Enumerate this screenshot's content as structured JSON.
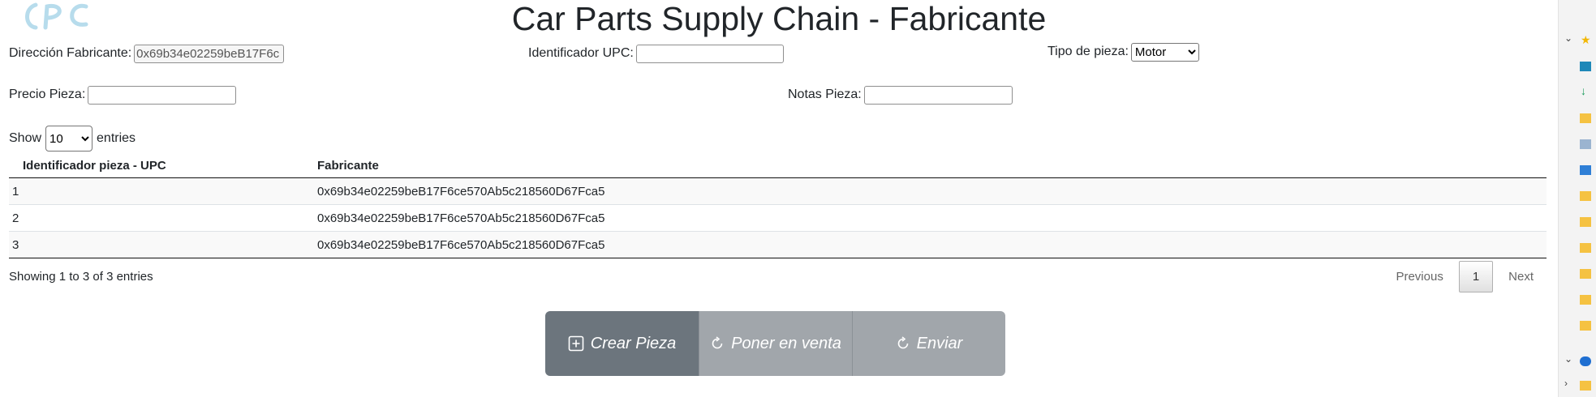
{
  "header": {
    "title": "Car Parts Supply Chain - Fabricante"
  },
  "form": {
    "manufacturer_label": "Dirección Fabricante:",
    "manufacturer_value": "0x69b34e02259beB17F6c",
    "upc_label": "Identificador UPC:",
    "upc_value": "",
    "part_type_label": "Tipo de pieza:",
    "part_type_selected": "Motor",
    "price_label": "Precio Pieza:",
    "price_value": "",
    "notes_label": "Notas Pieza:",
    "notes_value": ""
  },
  "table": {
    "length": {
      "show": "Show",
      "value": "10",
      "entries": "entries"
    },
    "columns": [
      "Identificador pieza - UPC",
      "Fabricante"
    ],
    "rows": [
      [
        "1",
        "0x69b34e02259beB17F6ce570Ab5c218560D67Fca5"
      ],
      [
        "2",
        "0x69b34e02259beB17F6ce570Ab5c218560D67Fca5"
      ],
      [
        "3",
        "0x69b34e02259beB17F6ce570Ab5c218560D67Fca5"
      ]
    ],
    "info": "Showing 1 to 3 of 3 entries",
    "pagination": {
      "previous": "Previous",
      "current": "1",
      "next": "Next"
    }
  },
  "actions": {
    "create_label": "Crear Pieza",
    "sell_label": "Poner en venta",
    "send_label": "Enviar"
  },
  "icons": {
    "create": "plus-square-icon",
    "sell": "refresh-icon",
    "send": "refresh-icon"
  },
  "colors": {
    "primary_button": "#6c757d",
    "disabled_button": "#a1a6ab"
  }
}
